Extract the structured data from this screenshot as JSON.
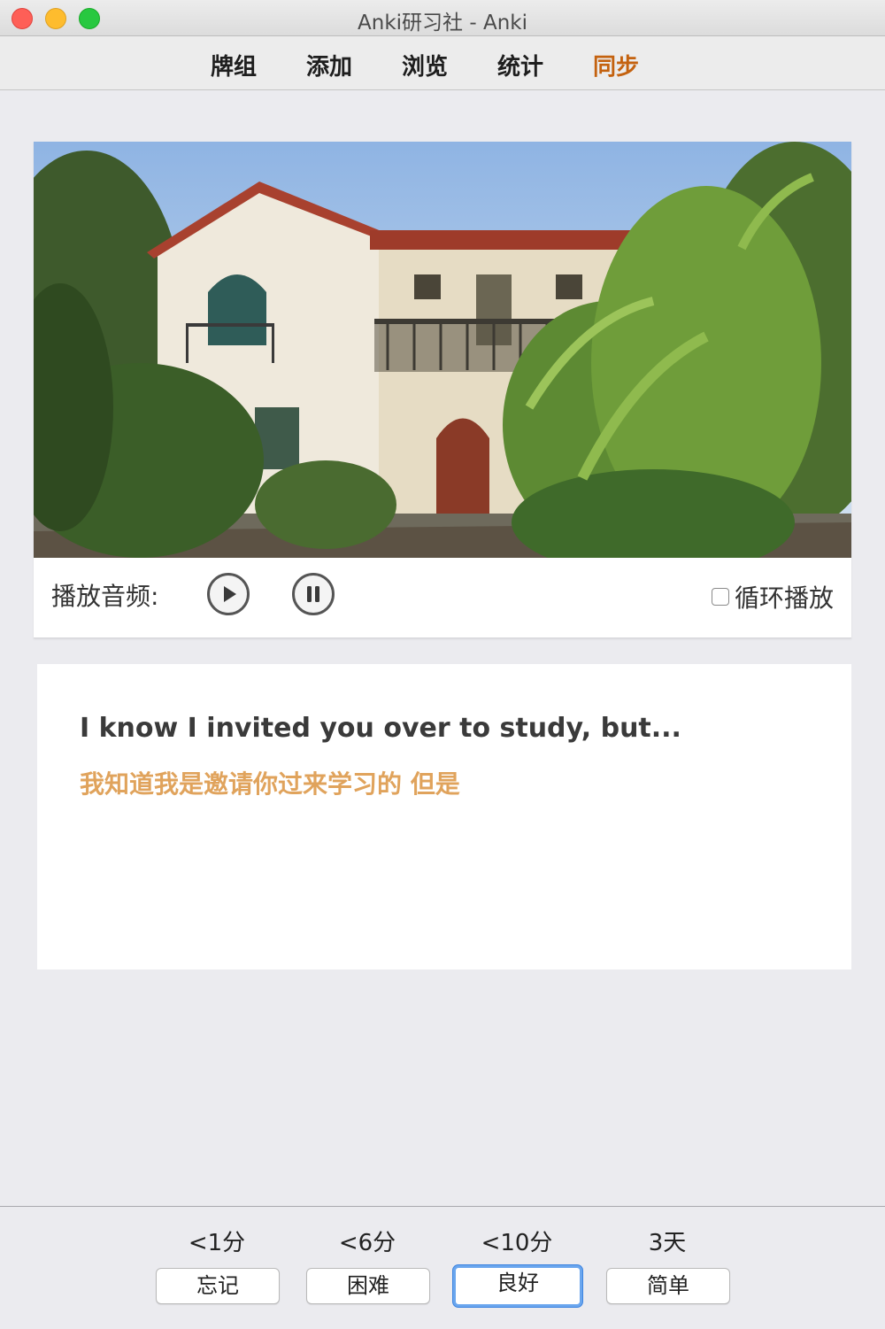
{
  "window": {
    "title": "Anki研习社 - Anki"
  },
  "toolbar": {
    "items": [
      {
        "label": "牌组"
      },
      {
        "label": "添加"
      },
      {
        "label": "浏览"
      },
      {
        "label": "统计"
      },
      {
        "label": "同步"
      }
    ]
  },
  "media": {
    "image_alt": "photo of a white Spanish-style two-story house with red tile roof surrounded by tropical plants",
    "audio_label": "播放音频:",
    "loop_label": "循环播放",
    "loop_checked": false
  },
  "card": {
    "english": "I know I invited you over to study, but...",
    "chinese": "我知道我是邀请你过来学习的  但是"
  },
  "answers": [
    {
      "interval": "<1分",
      "label": "忘记"
    },
    {
      "interval": "<6分",
      "label": "困难"
    },
    {
      "interval": "<10分",
      "label": "良好",
      "focused": true
    },
    {
      "interval": "3天",
      "label": "简单"
    }
  ],
  "colors": {
    "sync_accent": "#c4620f",
    "chinese_text": "#e0a35c",
    "focus_ring": "#6aa6ee"
  }
}
